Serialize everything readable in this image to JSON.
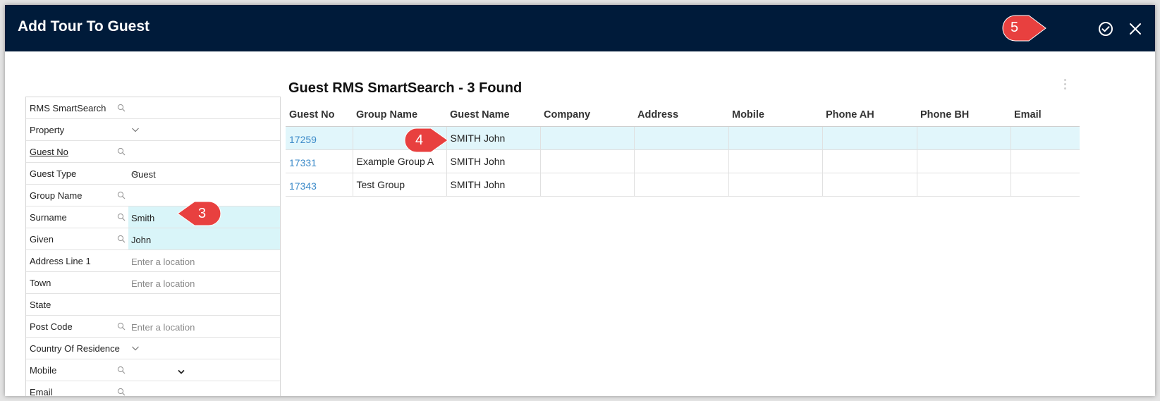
{
  "dialog": {
    "title": "Add Tour To Guest",
    "confirm_icon": "check-circle-icon",
    "close_icon": "close-icon"
  },
  "markers": {
    "step3": "3",
    "step4": "4",
    "step5": "5",
    "color": "#e8403f"
  },
  "colors": {
    "titlebar": "#001b3a",
    "highlight": "#d9f5f9",
    "selected_row": "#e1f6fb",
    "link": "#3d8bc9"
  },
  "form": {
    "fields": [
      {
        "label": "RMS SmartSearch",
        "search": true,
        "value": "",
        "placeholder": "",
        "dropdown": false
      },
      {
        "label": "Property",
        "search": false,
        "value": "",
        "placeholder": "",
        "dropdown": true
      },
      {
        "label": "Guest No",
        "search": true,
        "value": "",
        "placeholder": "",
        "dropdown": false,
        "underline": true
      },
      {
        "label": "Guest Type",
        "search": false,
        "value": "Guest",
        "placeholder": "",
        "dropdown": true
      },
      {
        "label": "Group Name",
        "search": true,
        "value": "",
        "placeholder": "",
        "dropdown": false
      },
      {
        "label": "Surname",
        "search": true,
        "value": "Smith",
        "placeholder": "",
        "dropdown": false,
        "highlight": true
      },
      {
        "label": "Given",
        "search": true,
        "value": "John",
        "placeholder": "",
        "dropdown": false,
        "highlight": true
      },
      {
        "label": "Address Line 1",
        "search": false,
        "value": "",
        "placeholder": "Enter a location",
        "dropdown": false
      },
      {
        "label": "Town",
        "search": false,
        "value": "",
        "placeholder": "Enter a location",
        "dropdown": false
      },
      {
        "label": "State",
        "search": false,
        "value": "",
        "placeholder": "",
        "dropdown": false
      },
      {
        "label": "Post Code",
        "search": true,
        "value": "",
        "placeholder": "Enter a location",
        "dropdown": false
      },
      {
        "label": "Country Of Residence",
        "search": false,
        "value": "",
        "placeholder": "",
        "dropdown": true
      },
      {
        "label": "Mobile",
        "search": true,
        "value": "",
        "placeholder": "",
        "dropdown": false,
        "inline_dropdown": true
      },
      {
        "label": "Email",
        "search": true,
        "value": "",
        "placeholder": "",
        "dropdown": false
      }
    ]
  },
  "results": {
    "title": "Guest RMS SmartSearch - 3 Found",
    "columns": [
      "Guest No",
      "Group Name",
      "Guest Name",
      "Company",
      "Address",
      "Mobile",
      "Phone AH",
      "Phone BH",
      "Email"
    ],
    "rows": [
      {
        "guest_no": "17259",
        "group_name": "",
        "guest_name": "SMITH John",
        "company": "",
        "address": "",
        "mobile": "",
        "phone_ah": "",
        "phone_bh": "",
        "email": "",
        "selected": true
      },
      {
        "guest_no": "17331",
        "group_name": "Example Group A",
        "guest_name": "SMITH John",
        "company": "",
        "address": "",
        "mobile": "",
        "phone_ah": "",
        "phone_bh": "",
        "email": "",
        "selected": false
      },
      {
        "guest_no": "17343",
        "group_name": "Test Group",
        "guest_name": "SMITH John",
        "company": "",
        "address": "",
        "mobile": "",
        "phone_ah": "",
        "phone_bh": "",
        "email": "",
        "selected": false
      }
    ]
  }
}
